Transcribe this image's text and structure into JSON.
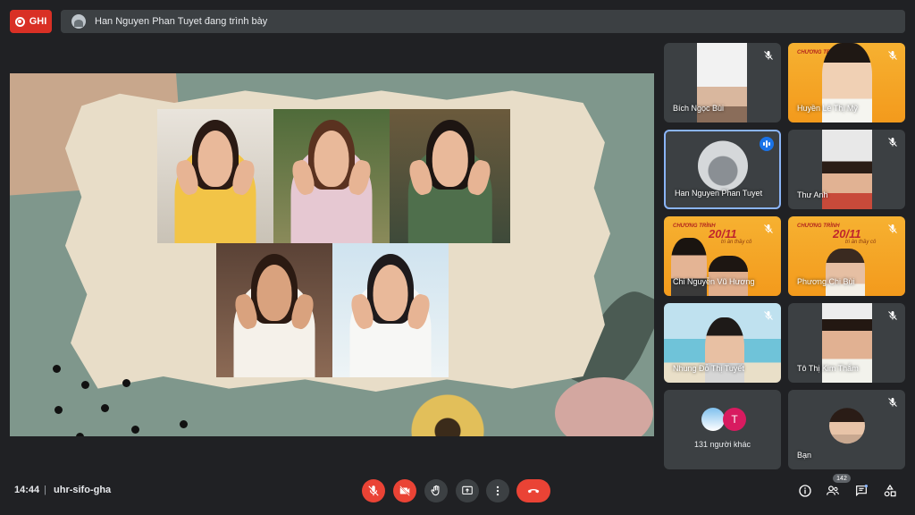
{
  "recording": {
    "label": "GHI"
  },
  "presenter": {
    "text": "Han Nguyen Phan Tuyet đang trình bày"
  },
  "participants": [
    {
      "name": "Bích Ngọc Bùi",
      "muted": true
    },
    {
      "name": "Huyền Lê Thị Mỹ",
      "muted": true
    },
    {
      "name": "Han Nguyen Phan Tuyet",
      "muted": false,
      "speaking": true
    },
    {
      "name": "Thư Anh",
      "muted": true
    },
    {
      "name": "Chi Nguyễn Vũ Hương",
      "muted": true
    },
    {
      "name": "Phương Chi Bùi",
      "muted": true
    },
    {
      "name": "Nhung Đỗ Thị Tuyết",
      "muted": true
    },
    {
      "name": "Tô Thị Kim Thắm",
      "muted": true
    },
    {
      "name": "Bạn",
      "muted": true
    }
  ],
  "others": {
    "label": "131 người khác",
    "avatar_letter": "T"
  },
  "banner": {
    "top": "CHƯƠNG TRÌNH",
    "main": "20/11",
    "sub": "tri ân thầy cô"
  },
  "footer": {
    "time": "14:44",
    "separator": "|",
    "meeting_code": "uhr-sifo-gha"
  },
  "people_count": "142",
  "colors": {
    "accent": "#8ab4f8",
    "danger": "#ea4335",
    "background": "#202124",
    "tile": "#3c4043"
  }
}
